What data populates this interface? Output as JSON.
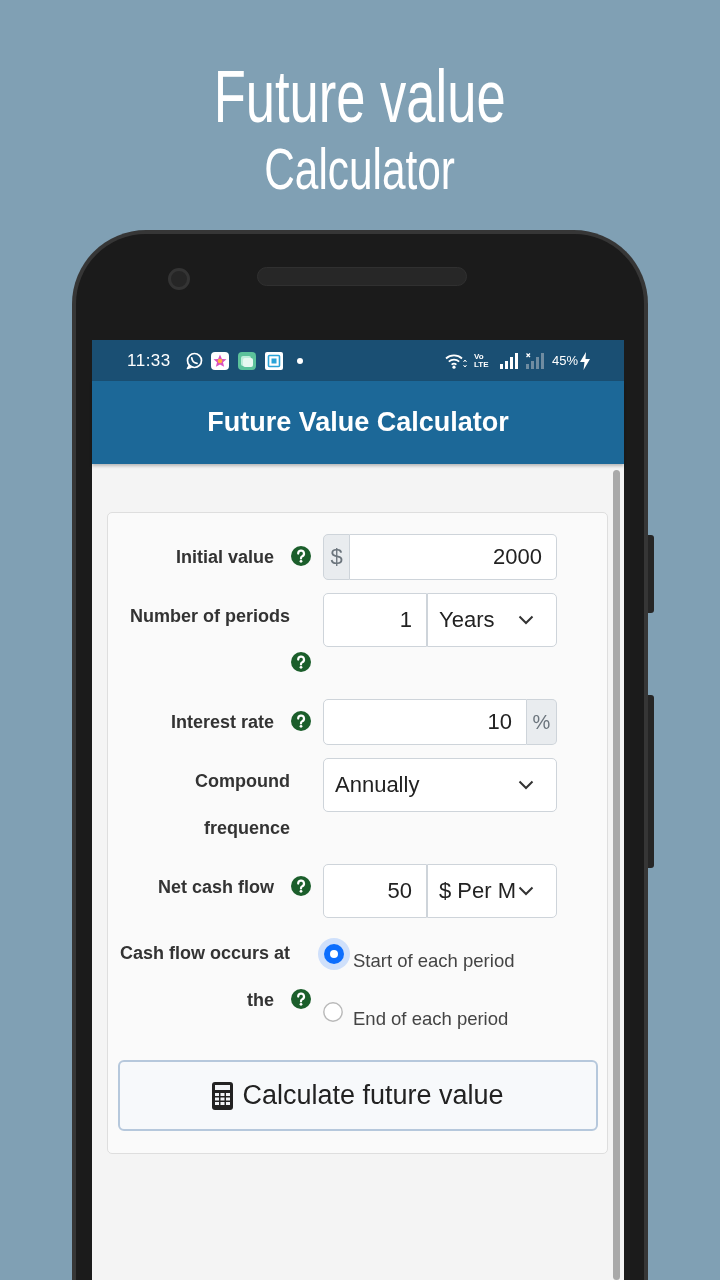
{
  "promo": {
    "title": "Future value",
    "subtitle": "Calculator"
  },
  "status_bar": {
    "time": "11:33",
    "network": "Vo LTE",
    "battery": "45%",
    "charging": true
  },
  "app_bar": {
    "title": "Future Value Calculator"
  },
  "form": {
    "fields": [
      {
        "kind": "prefixed",
        "label": "Initial value",
        "help": true,
        "prefix": "$",
        "value": "2000"
      },
      {
        "kind": "with_unit",
        "label": "Number of periods",
        "help": true,
        "value": "1",
        "unit": "Years"
      },
      {
        "kind": "suffixed",
        "label": "Interest rate",
        "help": true,
        "value": "10",
        "suffix": "%"
      },
      {
        "kind": "dropdown",
        "label": "Compound frequence",
        "help": false,
        "selection": "Annually"
      },
      {
        "kind": "with_unit",
        "label": "Net cash flow",
        "help": true,
        "value": "50",
        "unit": "$ Per M"
      },
      {
        "kind": "radio",
        "label": "Cash flow occurs at the",
        "help": true,
        "options": [
          {
            "label": "Start of each period",
            "selected": true
          },
          {
            "label": "End of each period",
            "selected": false
          }
        ]
      }
    ]
  },
  "calculate_button": {
    "label": "Calculate future value"
  }
}
